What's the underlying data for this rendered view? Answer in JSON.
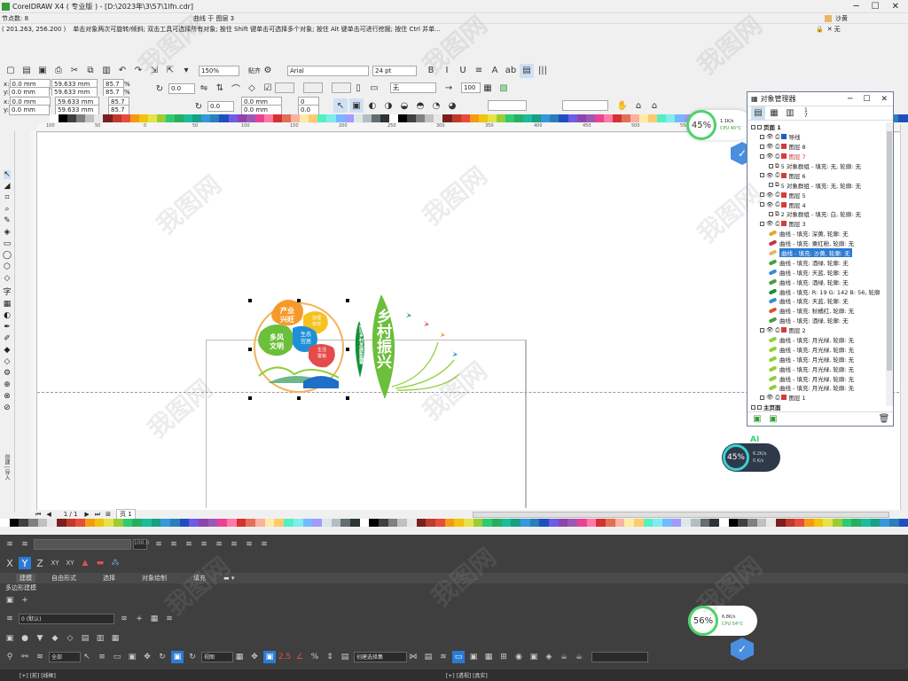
{
  "app": {
    "title": "CorelDRAW X4 ( 专业版 ) - [D:\\2023年\\3\\57\\1lfn.cdr]",
    "nodes": "节点数: 8",
    "selection_info": "曲线 于 图层 3",
    "fill_label": "沙黄",
    "outline_label": "无"
  },
  "status_hint": {
    "coords": "( 201.263, 256.200 )",
    "message": "单击对象两次可旋转/倾斜; 双击工具可选择所有对象; 按住 Shift 键单击可选择多个对象; 按住 Alt 键单击可进行挖掘; 按住 Ctrl 并单..."
  },
  "toolbar": {
    "zoom": "150%",
    "snap": "贴齐",
    "font": "Arial",
    "font_size": "24 pt"
  },
  "propbar": {
    "x": "0.0 mm",
    "y": "0.0 mm",
    "w": "59.633 mm",
    "h": "59.633 mm",
    "sx": "85.7",
    "sy": "85.7",
    "pct": "%",
    "angle": "0.0",
    "outline_none": "无",
    "opacity": "100"
  },
  "propbar2": {
    "x": "0.0 mm",
    "y": "0.0 mm",
    "w": "59.633 mm",
    "h": "59.633 mm",
    "sx": "85.7",
    "sy": "85.7",
    "angle": "0.0",
    "r1": "0.0 mm",
    "r2": "0.0 mm",
    "v1": "0",
    "v2": "0.0"
  },
  "ruler_ticks": [
    "100",
    "50",
    "0",
    "50",
    "100",
    "150",
    "200",
    "250",
    "300",
    "350",
    "400",
    "450",
    "500",
    "550",
    "600",
    "650",
    "700"
  ],
  "page_nav": {
    "count": "1 / 1",
    "tab": "页 1"
  },
  "artwork": {
    "circle_labels": [
      "产业\n兴旺",
      "治理\n有效",
      "多风\n文明",
      "生态\n宜居",
      "生活\n富裕"
    ],
    "vertical_slogan": "推动乡村发展新篇章",
    "big_title": "乡村振兴"
  },
  "cpu_widget": {
    "percent": "45%",
    "up": "1.1K/s",
    "cpu": "CPU 40°C"
  },
  "cpu_widget2": {
    "percent": "45%",
    "up": "6.2K/s",
    "down": "0 K/s",
    "ai": "AI"
  },
  "cpu_widget3": {
    "percent": "56%",
    "up": "6.8K/s",
    "cpu": "CPU 54°C"
  },
  "docker": {
    "title": "对象管理器",
    "page_count": "1\n7",
    "tree": [
      {
        "indent": 0,
        "text": "页面 1",
        "kind": "page"
      },
      {
        "indent": 1,
        "text": "导线",
        "kind": "layer",
        "color": "#1f5fbf"
      },
      {
        "indent": 1,
        "text": "图层 8",
        "kind": "layer",
        "color": "#d43c3c"
      },
      {
        "indent": 1,
        "text": "图层 7",
        "kind": "layer",
        "color": "#d43c3c",
        "red": true
      },
      {
        "indent": 2,
        "text": "5 对象群组 - 填充: 无, 轮廓: 无",
        "kind": "group"
      },
      {
        "indent": 1,
        "text": "图层 6",
        "kind": "layer",
        "color": "#d43c3c"
      },
      {
        "indent": 2,
        "text": "5 对象群组 - 填充: 无, 轮廓: 无",
        "kind": "group"
      },
      {
        "indent": 1,
        "text": "图层 5",
        "kind": "layer",
        "color": "#d43c3c"
      },
      {
        "indent": 1,
        "text": "图层 4",
        "kind": "layer",
        "color": "#d43c3c"
      },
      {
        "indent": 2,
        "text": "2 对象群组 - 填充: 白, 轮廓: 无",
        "kind": "group"
      },
      {
        "indent": 1,
        "text": "图层 3",
        "kind": "layer",
        "color": "#d43c3c"
      },
      {
        "indent": 2,
        "text": "曲线 - 填充: 深黄, 轮廓: 无",
        "kind": "curve",
        "color": "#e3a92a"
      },
      {
        "indent": 2,
        "text": "曲线 - 填充: 粟红粉, 轮廓: 无",
        "kind": "curve",
        "color": "#c4334a"
      },
      {
        "indent": 2,
        "text": "曲线 - 填充: 沙黄, 轮廓: 无",
        "kind": "curve",
        "color": "#e8b66a",
        "selected": true
      },
      {
        "indent": 2,
        "text": "曲线 - 填充: 酒绿, 轮廓: 无",
        "kind": "curve",
        "color": "#4a9e3a"
      },
      {
        "indent": 2,
        "text": "曲线 - 填充: 天蓝, 轮廓: 无",
        "kind": "curve",
        "color": "#2f8fd8"
      },
      {
        "indent": 2,
        "text": "曲线 - 填充: 酒绿, 轮廓: 无",
        "kind": "curve",
        "color": "#4a9e3a"
      },
      {
        "indent": 2,
        "text": "曲线 - 填充: R: 19 G: 142 B: 56, 轮廓",
        "kind": "curve",
        "color": "#138e38"
      },
      {
        "indent": 2,
        "text": "曲线 - 填充: 天蓝, 轮廓: 无",
        "kind": "curve",
        "color": "#2f8fd8"
      },
      {
        "indent": 2,
        "text": "曲线 - 填充: 秋橘红, 轮廓: 无",
        "kind": "curve",
        "color": "#e0522b"
      },
      {
        "indent": 2,
        "text": "曲线 - 填充: 酒绿, 轮廓: 无",
        "kind": "curve",
        "color": "#4a9e3a"
      },
      {
        "indent": 1,
        "text": "图层 2",
        "kind": "layer",
        "color": "#d43c3c"
      },
      {
        "indent": 2,
        "text": "曲线 - 填充: 月光绿, 轮廓: 无",
        "kind": "curve",
        "color": "#8fcf3a"
      },
      {
        "indent": 2,
        "text": "曲线 - 填充: 月光绿, 轮廓: 无",
        "kind": "curve",
        "color": "#8fcf3a"
      },
      {
        "indent": 2,
        "text": "曲线 - 填充: 月光绿, 轮廓: 无",
        "kind": "curve",
        "color": "#8fcf3a"
      },
      {
        "indent": 2,
        "text": "曲线 - 填充: 月光绿, 轮廓: 无",
        "kind": "curve",
        "color": "#8fcf3a"
      },
      {
        "indent": 2,
        "text": "曲线 - 填充: 月光绿, 轮廓: 无",
        "kind": "curve",
        "color": "#8fcf3a"
      },
      {
        "indent": 2,
        "text": "曲线 - 填充: 月光绿, 轮廓: 无",
        "kind": "curve",
        "color": "#8fcf3a"
      },
      {
        "indent": 1,
        "text": "图层 1",
        "kind": "layer",
        "color": "#d43c3c"
      },
      {
        "indent": 0,
        "text": "主页面",
        "kind": "page"
      }
    ]
  },
  "max": {
    "tabs": [
      "建模",
      "自由形式",
      "选择",
      "对象绘制",
      "填充"
    ],
    "poly_label": "多边形建模",
    "axis_x": "X",
    "axis_y": "Y",
    "axis_z": "Z",
    "axis_xy": "XY",
    "axis_xy2": "XY",
    "layer_default": "0 (默认)",
    "filter_all": "全部",
    "view_label": "视图",
    "selection_set": "创建选择集",
    "viewport1": "[+] [前] [线框]",
    "viewport2": "[+] [透视] [真实]",
    "spinner_val": "100.0",
    "left_vertical": "创建 | 导入"
  },
  "watermark": "我图网"
}
